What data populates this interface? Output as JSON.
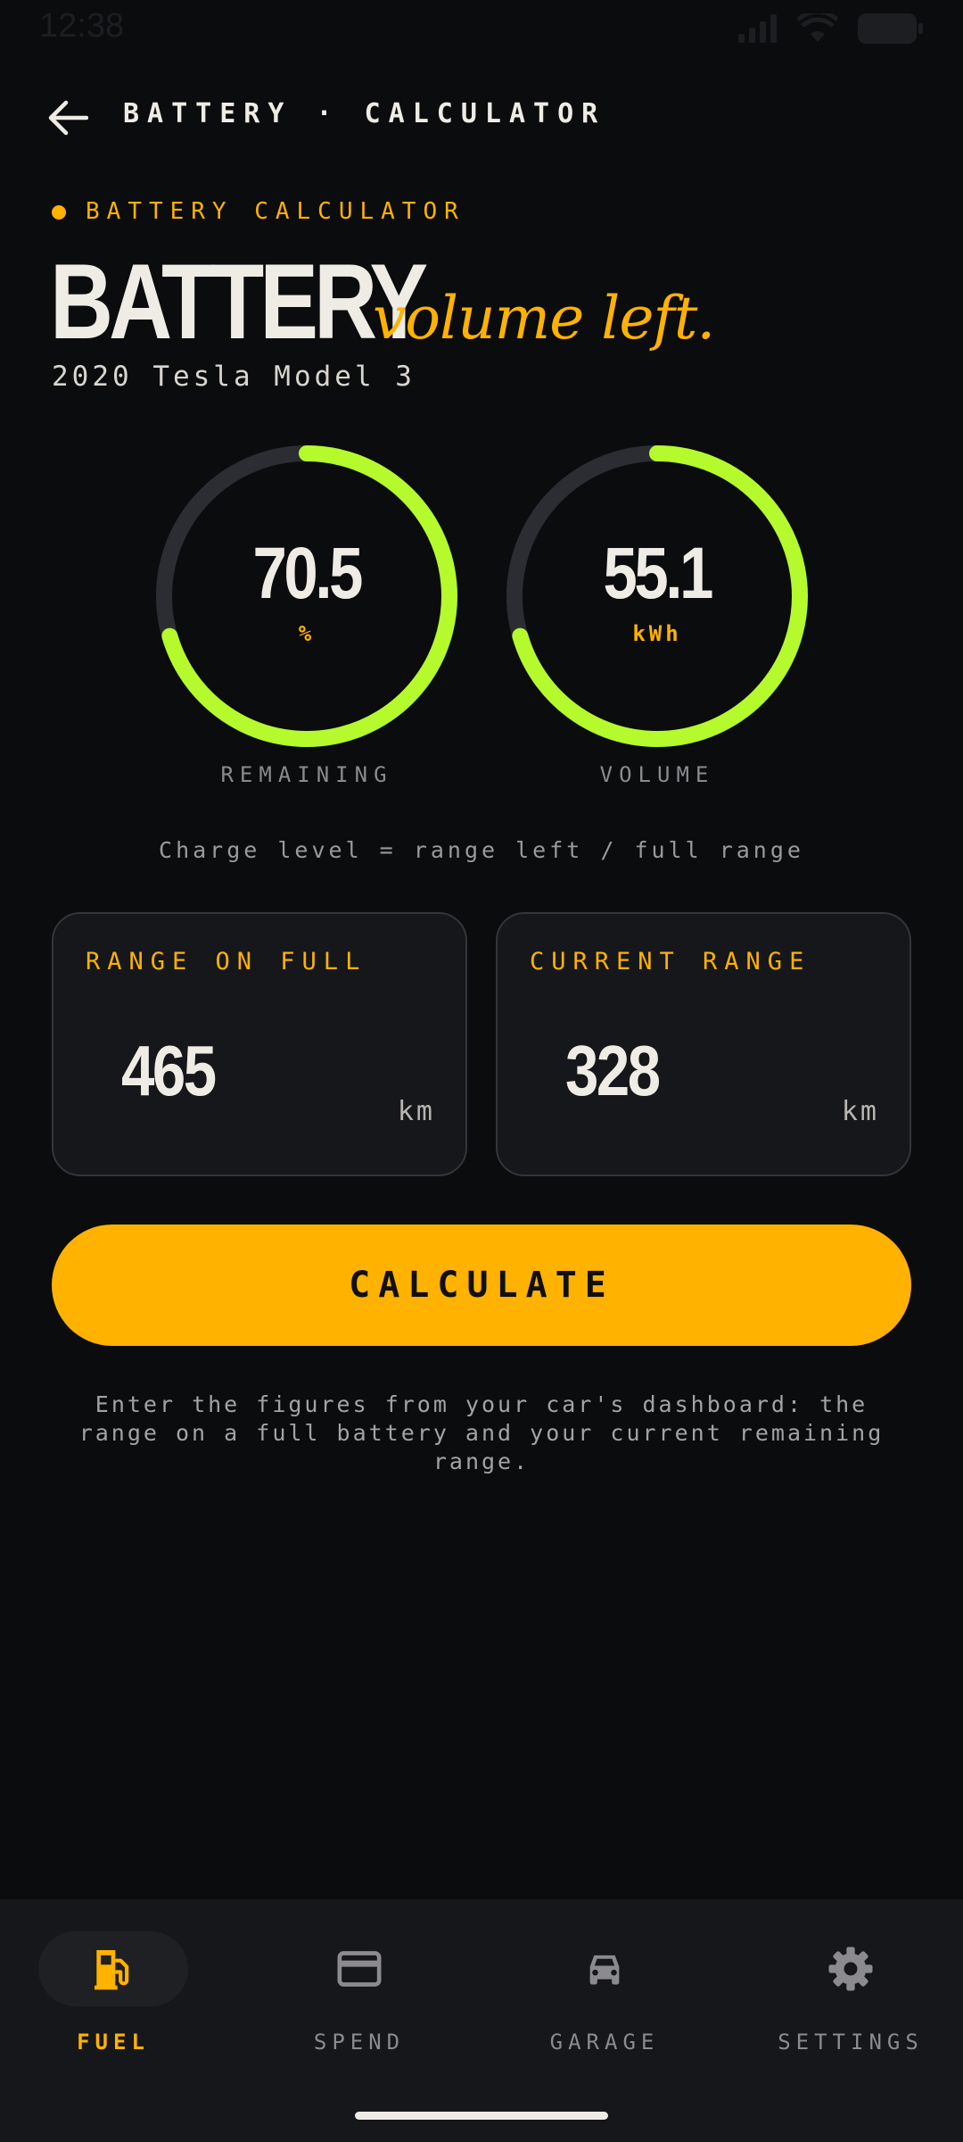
{
  "status_bar": {
    "time": "12:38"
  },
  "header": {
    "title": "BATTERY · CALCULATOR"
  },
  "hero": {
    "eyebrow": "BATTERY CALCULATOR",
    "title_main": "BATTERY",
    "title_italic": "volume left.",
    "car": "2020 Tesla Model 3"
  },
  "gauges": [
    {
      "value": "70.5",
      "unit": "%",
      "label": "REMAINING",
      "fraction": 0.705
    },
    {
      "value": "55.1",
      "unit": "kWh",
      "label": "VOLUME",
      "fraction": 0.705
    }
  ],
  "formula": "Charge level = range left / full range",
  "inputs": {
    "full": {
      "label": "RANGE ON FULL",
      "value": "465",
      "unit": "km"
    },
    "current": {
      "label": "CURRENT RANGE",
      "value": "328",
      "unit": "km"
    }
  },
  "calculate_label": "CALCULATE",
  "help_text": "Enter the figures from your car's dashboard: the range on a full battery and your current remaining range.",
  "nav": [
    {
      "label": "FUEL",
      "icon": "fuel-pump-icon",
      "active": true
    },
    {
      "label": "SPEND",
      "icon": "credit-card-icon",
      "active": false
    },
    {
      "label": "GARAGE",
      "icon": "car-icon",
      "active": false
    },
    {
      "label": "SETTINGS",
      "icon": "gear-icon",
      "active": false
    }
  ],
  "colors": {
    "background": "#0b0c0e",
    "accent": "#ffb200",
    "gauge": "#b4fa2c",
    "gauge_track": "#2b2d33",
    "card": "#16171a"
  }
}
